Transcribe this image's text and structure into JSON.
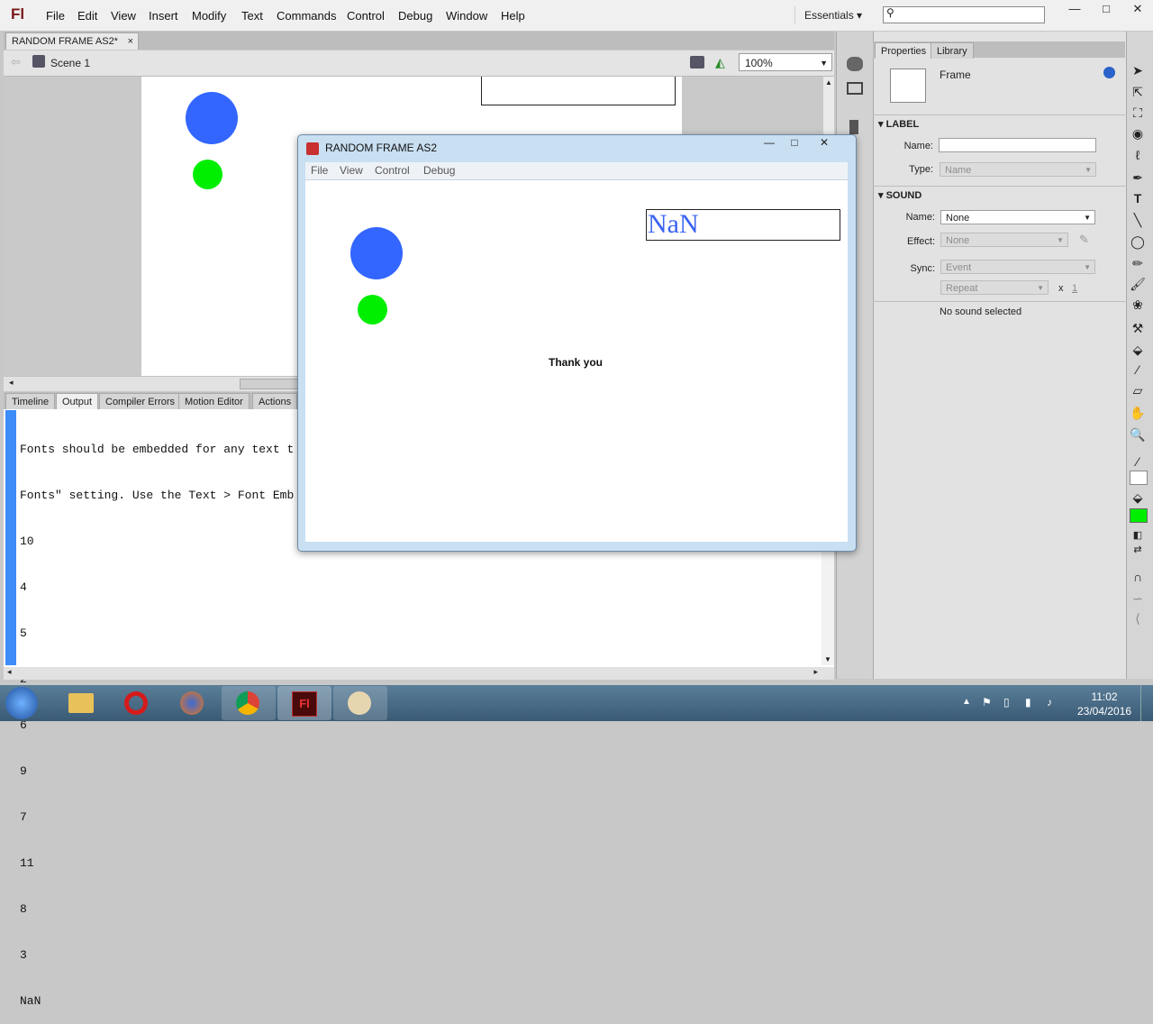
{
  "app": {
    "logo": "Fl",
    "workspace": "Essentials ▾"
  },
  "menu": [
    "File",
    "Edit",
    "View",
    "Insert",
    "Modify",
    "Text",
    "Commands",
    "Control",
    "Debug",
    "Window",
    "Help"
  ],
  "window_controls": {
    "minimize": "—",
    "maximize": "□",
    "close": "✕"
  },
  "document": {
    "tab_title": "RANDOM FRAME AS2*",
    "tab_close": "×",
    "scene": "Scene 1",
    "zoom": "100%"
  },
  "bottom_tabs": [
    "Timeline",
    "Output",
    "Compiler Errors",
    "Motion Editor",
    "Actions"
  ],
  "output": {
    "lines": [
      "Fonts should be embedded for any text t",
      "Fonts\" setting. Use the Text > Font Emb",
      "10",
      "4",
      "5",
      "2",
      "6",
      "9",
      "7",
      "11",
      "8",
      "3",
      "NaN"
    ]
  },
  "properties": {
    "tabs": [
      "Properties",
      "Library"
    ],
    "object_type": "Frame",
    "label_section": "LABEL",
    "name_label": "Name:",
    "name_value": "",
    "type_label": "Type:",
    "type_value": "Name",
    "sound_section": "SOUND",
    "sound_name_label": "Name:",
    "sound_name_value": "None",
    "effect_label": "Effect:",
    "effect_value": "None",
    "sync_label": "Sync:",
    "sync_value": "Event",
    "repeat_value": "Repeat",
    "repeat_x": "x",
    "repeat_count": "1",
    "status": "No sound selected"
  },
  "player": {
    "title": "RANDOM FRAME AS2",
    "menu": [
      "File",
      "View",
      "Control",
      "Debug"
    ],
    "text_field_value": "NaN",
    "message": "Thank you"
  },
  "colors": {
    "blue_circle": "#3366ff",
    "green_circle": "#00ee00",
    "fill_swatch": "#00ee00",
    "nan_text": "#3b63f0"
  },
  "taskbar": {
    "time": "11:02",
    "date": "23/04/2016"
  }
}
